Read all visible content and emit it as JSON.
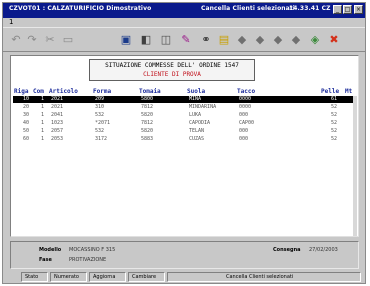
{
  "window": {
    "title_left": "CZVOT01 : CALZATURIFICIO Dimostrativo",
    "title_mid": "Cancella Clienti selezionati",
    "title_time": "14.33.41 CZ",
    "btn_min": "_",
    "btn_max": "□",
    "btn_close": "×"
  },
  "menubar": {
    "menu_label": "1"
  },
  "toolbar": {
    "icons": {
      "undo": "undo-icon",
      "cut": "cut-icon",
      "print": "print-icon",
      "save": "disk-icon",
      "edit": "edit-icon",
      "find": "binoculars-icon",
      "delete": "delete-icon"
    },
    "glyphs": {
      "undo": "↶",
      "redo": "↷",
      "cut": "✂",
      "copy": "▭",
      "print": "▣",
      "save": "◧",
      "preview": "◫",
      "edit": "✎",
      "find": "⚭",
      "delete": "●",
      "folder": "▤",
      "first": "◆",
      "prev": "◆",
      "next": "◆",
      "last": "◆",
      "refresh": "◈",
      "stop": "✖"
    }
  },
  "panel": {
    "title_line1": "SITUAZIONE COMMESSE DELL' ORDINE  1547",
    "title_line2": "CLIENTE DI PROVA",
    "columns": [
      "Riga",
      "Com",
      "Articolo",
      "Forma",
      "Tomaia",
      "Suola",
      "Tacco",
      "Pelle",
      "Mt"
    ],
    "rows": [
      [
        "10",
        "1",
        "2021",
        "209",
        "5800",
        "MINA",
        "0000",
        "61",
        "3"
      ],
      [
        "20",
        "1",
        "2021",
        "310",
        "7812",
        "MINDARINA",
        "0000",
        "52",
        "5"
      ],
      [
        "30",
        "1",
        "2041",
        "532",
        "5820",
        "LUKA",
        "000",
        "52",
        "5"
      ],
      [
        "40",
        "1",
        "1023",
        "*2071",
        "7812",
        "CAPODIA",
        "CAP00",
        "52",
        "5"
      ],
      [
        "50",
        "1",
        "2057",
        "532",
        "5820",
        "TELAN",
        "000",
        "52",
        "5"
      ],
      [
        "60",
        "1",
        "2053",
        "3172",
        "5883",
        "CUZAS",
        "000",
        "52",
        "5"
      ]
    ],
    "selected_row": 0
  },
  "bottom": {
    "modello_label": "Modello",
    "modello_value": "MOCASSINO F 315",
    "fase_label": "Fase",
    "fase_value": "PROTIVAZIONE",
    "consegna_label": "Consegna",
    "consegna_value": "27/02/2003"
  },
  "status": {
    "b1": "Stato",
    "b2": "Numerato",
    "b3": "Aggiorna",
    "b4": "Cambiare",
    "message": "Cancella Clienti selezionati"
  }
}
